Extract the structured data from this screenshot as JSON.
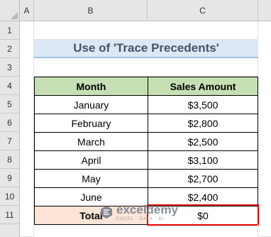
{
  "columns": [
    "A",
    "B",
    "C"
  ],
  "rows": [
    "1",
    "2",
    "3",
    "4",
    "5",
    "6",
    "7",
    "8",
    "9",
    "10",
    "11"
  ],
  "title": "Use of 'Trace Precedents'",
  "table": {
    "headers": [
      "Month",
      "Sales Amount"
    ],
    "data": [
      [
        "January",
        "$3,500"
      ],
      [
        "February",
        "$2,800"
      ],
      [
        "March",
        "$2,500"
      ],
      [
        "April",
        "$3,100"
      ],
      [
        "May",
        "$2,700"
      ],
      [
        "June",
        "$2,400"
      ]
    ],
    "total_label": "Total",
    "total_value": "$0"
  },
  "watermark": {
    "name": "exceldemy",
    "tagline": "EXCEL · DATA · BI"
  },
  "colors": {
    "header_fill": "#c6e0b4",
    "title_fill": "#dce8f5",
    "total_fill": "#fce4d6",
    "highlight_border": "#e00000"
  }
}
